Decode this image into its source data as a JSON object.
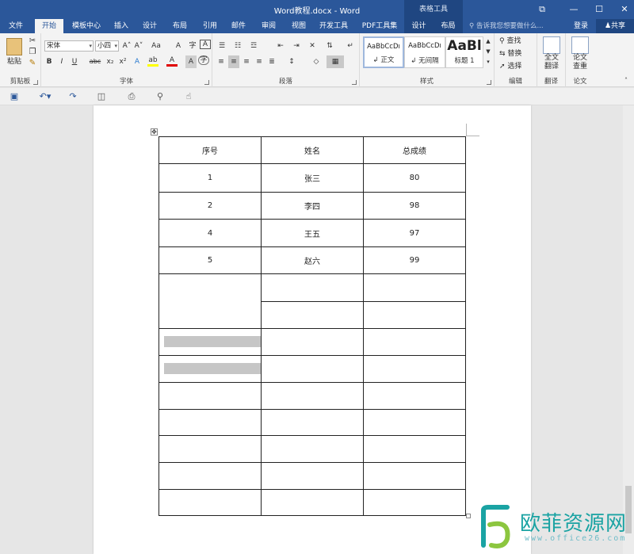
{
  "titlebar": {
    "title": "Word教程.docx - Word",
    "context_header": "表格工具",
    "restore_glyph": "⧉",
    "minimize_glyph": "—",
    "maximize_glyph": "☐",
    "close_glyph": "✕"
  },
  "tabs": [
    {
      "label": "文件"
    },
    {
      "label": "开始",
      "active": true
    },
    {
      "label": "模板中心"
    },
    {
      "label": "插入"
    },
    {
      "label": "设计"
    },
    {
      "label": "布局"
    },
    {
      "label": "引用"
    },
    {
      "label": "邮件"
    },
    {
      "label": "审阅"
    },
    {
      "label": "视图"
    },
    {
      "label": "开发工具"
    },
    {
      "label": "PDF工具集"
    },
    {
      "label": "设计",
      "context": true
    },
    {
      "label": "布局",
      "context": true
    }
  ],
  "tellme": {
    "text": "告诉我您想要做什么..."
  },
  "account": {
    "login": "登录",
    "share": "共享"
  },
  "ribbon": {
    "clipboard": {
      "label": "剪贴板",
      "paste": "粘贴"
    },
    "font": {
      "label": "字体",
      "font_name": "宋体",
      "font_size": "小四",
      "grow": "A˄",
      "shrink": "A˅",
      "case": "Aa",
      "clear": "A",
      "bold": "B",
      "italic": "I",
      "underline": "U",
      "strike": "abc",
      "subscript": "x₂",
      "superscript": "x²",
      "text_effect": "A",
      "highlight": "ab",
      "font_color": "A",
      "char_shade": "A",
      "enclose": "字"
    },
    "paragraph": {
      "label": "段落"
    },
    "styles": {
      "label": "样式",
      "items": [
        {
          "sample": "AaBbCcDı",
          "name": "↲ 正文"
        },
        {
          "sample": "AaBbCcDı",
          "name": "↲ 无间隔"
        },
        {
          "sample": "AaBl",
          "name": "标题 1"
        }
      ]
    },
    "editing": {
      "label": "编辑",
      "find": "查找",
      "replace": "替换",
      "select": "选择"
    },
    "translate": {
      "label": "翻译",
      "full": "全文",
      "full2": "翻译"
    },
    "paper": {
      "label": "论文",
      "check": "论文",
      "check2": "查重"
    }
  },
  "table": {
    "header": [
      "序号",
      "姓名",
      "总成绩"
    ],
    "rows": [
      [
        "1",
        "张三",
        "80"
      ],
      [
        "2",
        "李四",
        "98"
      ],
      [
        "4",
        "王五",
        "97"
      ],
      [
        "5",
        "赵六",
        "99"
      ]
    ]
  },
  "watermark": {
    "text": "欧菲资源网",
    "url": "www.office26.com"
  },
  "colors": {
    "accent": "#2b579a",
    "accent_dark": "#1f4681",
    "watermark": "#1aa3a3"
  }
}
